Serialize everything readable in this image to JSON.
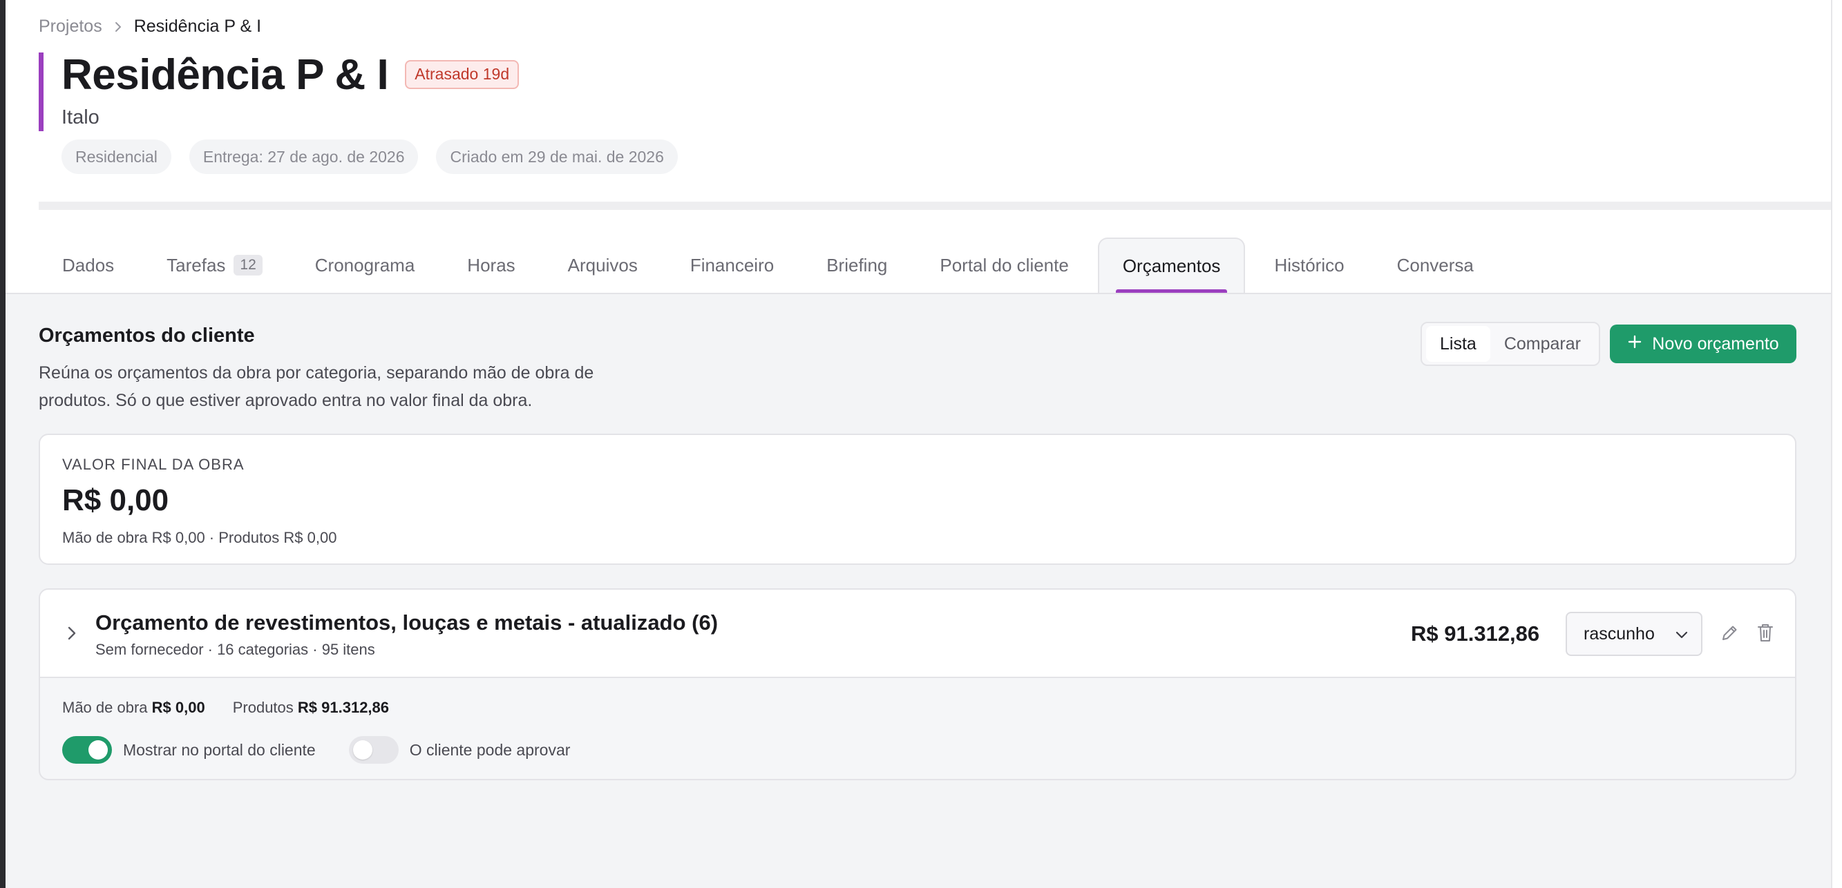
{
  "breadcrumb": {
    "root": "Projetos",
    "current": "Residência P & I"
  },
  "project": {
    "title": "Residência P & I",
    "late_badge": "Atrasado 19d",
    "client": "Italo",
    "meta": {
      "type": "Residencial",
      "delivery": "Entrega: 27 de ago. de 2026",
      "created": "Criado em 29 de mai. de 2026"
    },
    "accent_color": "#9b3fbf"
  },
  "tabs": [
    {
      "label": "Dados"
    },
    {
      "label": "Tarefas",
      "count": "12"
    },
    {
      "label": "Cronograma"
    },
    {
      "label": "Horas"
    },
    {
      "label": "Arquivos"
    },
    {
      "label": "Financeiro"
    },
    {
      "label": "Briefing"
    },
    {
      "label": "Portal do cliente"
    },
    {
      "label": "Orçamentos",
      "active": true
    },
    {
      "label": "Histórico"
    },
    {
      "label": "Conversa"
    }
  ],
  "section": {
    "title": "Orçamentos do cliente",
    "description": "Reúna os orçamentos da obra por categoria, separando mão de obra de produtos. Só o que estiver aprovado entra no valor final da obra."
  },
  "view_toggle": {
    "list": "Lista",
    "compare": "Comparar",
    "selected": "Lista"
  },
  "new_button": {
    "label": "Novo orçamento",
    "color": "#1f9b6a"
  },
  "total": {
    "label": "VALOR FINAL DA OBRA",
    "value": "R$ 0,00",
    "breakdown": "Mão de obra R$ 0,00 · Produtos R$ 0,00"
  },
  "budget": {
    "name": "Orçamento de revestimentos, louças e metais - atualizado (6)",
    "subtitle": "Sem fornecedor · 16 categorias · 95 itens",
    "amount": "R$ 91.312,86",
    "status": "rascunho",
    "labor_label": "Mão de obra",
    "labor_value": "R$ 0,00",
    "products_label": "Produtos",
    "products_value": "R$ 91.312,86",
    "toggle_portal": {
      "label": "Mostrar no portal do cliente",
      "on": true
    },
    "toggle_approve": {
      "label": "O cliente pode aprovar",
      "on": false
    }
  }
}
